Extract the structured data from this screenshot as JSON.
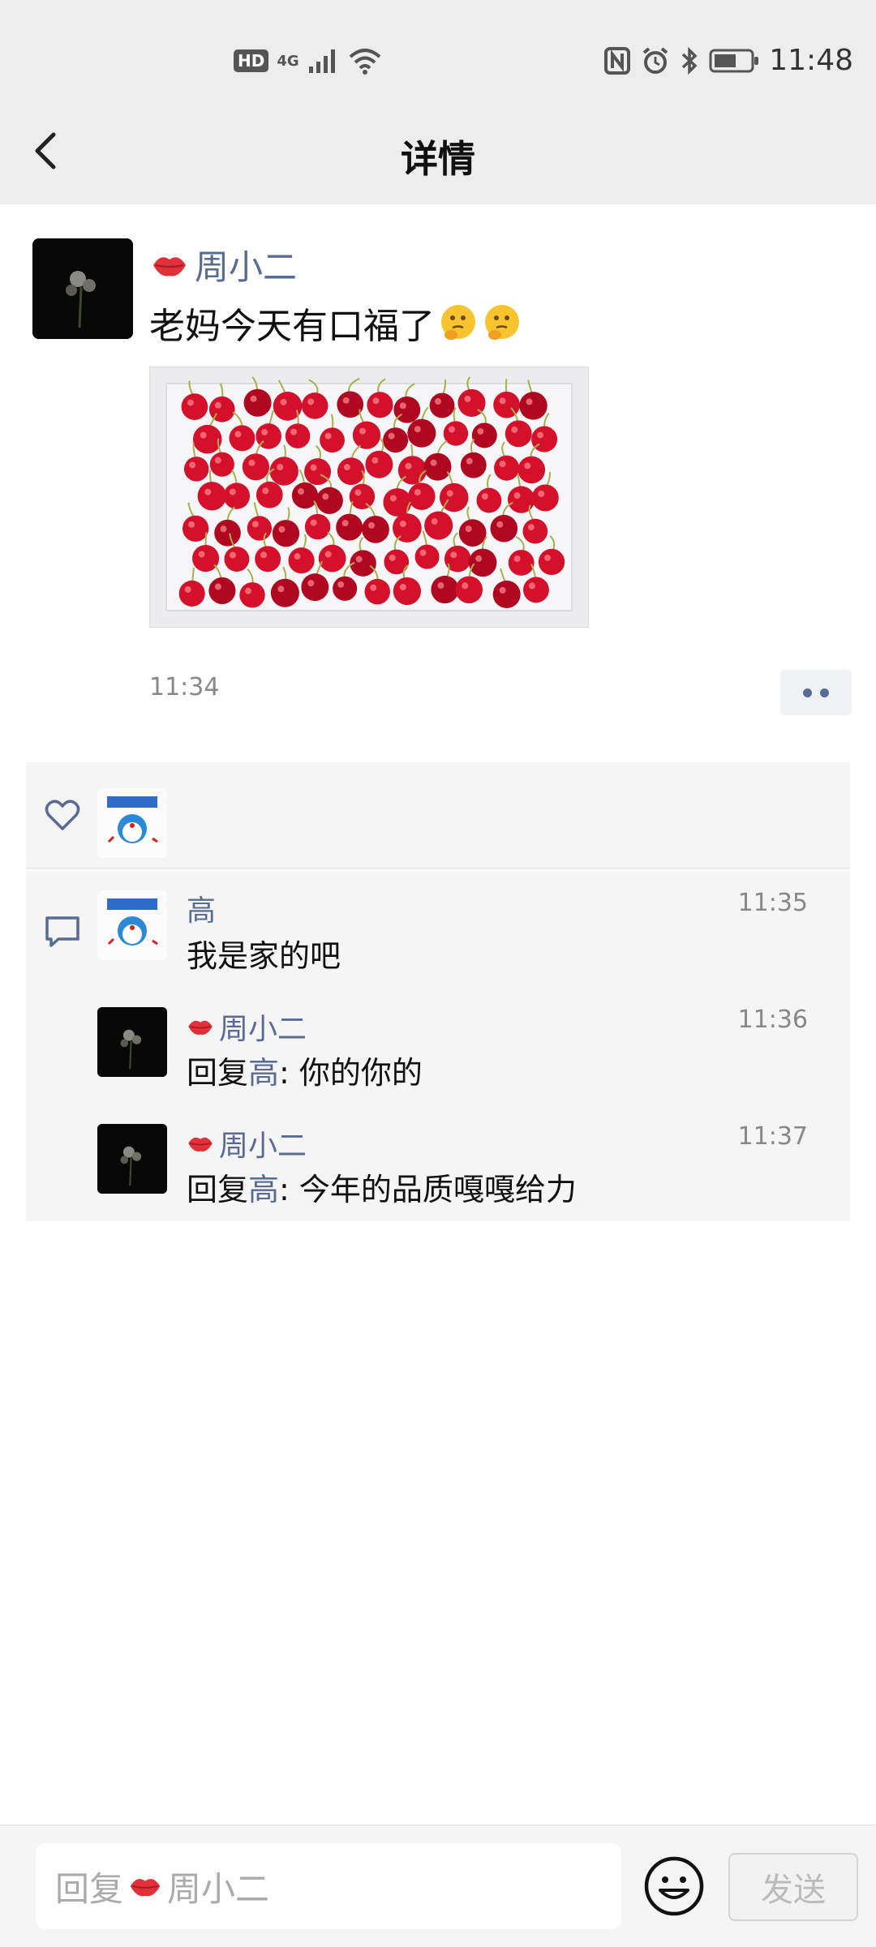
{
  "status_bar": {
    "network_badge": "HD",
    "network_type": "4G",
    "time": "11:48",
    "icons": [
      "signal-icon",
      "wifi-icon",
      "nfc-icon",
      "alarm-icon",
      "bluetooth-icon",
      "battery-icon"
    ]
  },
  "header": {
    "title": "详情",
    "back_icon": "chevron-left-icon"
  },
  "post": {
    "author": "周小二",
    "name_icon": "lips-icon",
    "text": "老妈今天有口福了",
    "text_emojis": [
      "thinking-face-icon",
      "thinking-face-icon"
    ],
    "image_subject": "cherries-in-white-box",
    "time": "11:34",
    "more_icon": "more-dots-icon"
  },
  "likes": {
    "icon": "heart-icon",
    "users": [
      "doraemon-avatar"
    ]
  },
  "comments": [
    {
      "author": "高",
      "text": "我是家的吧",
      "time": "11:35"
    },
    {
      "author": "周小二",
      "reply_prefix": "回复",
      "reply_to": "高",
      "separator": ": ",
      "text": "你的你的",
      "time": "11:36"
    },
    {
      "author": "周小二",
      "reply_prefix": "回复",
      "reply_to": "高",
      "separator": ": ",
      "text": "今年的品质嘎嘎给力",
      "time": "11:37"
    }
  ],
  "bottom_bar": {
    "placeholder_prefix": "回复",
    "placeholder_name": "周小二",
    "send_label": "发送",
    "emoji_icon": "smiley-icon"
  },
  "colors": {
    "name_blue": "#576b95",
    "background_gray": "#ededed",
    "panel_gray": "#f5f5f5"
  }
}
